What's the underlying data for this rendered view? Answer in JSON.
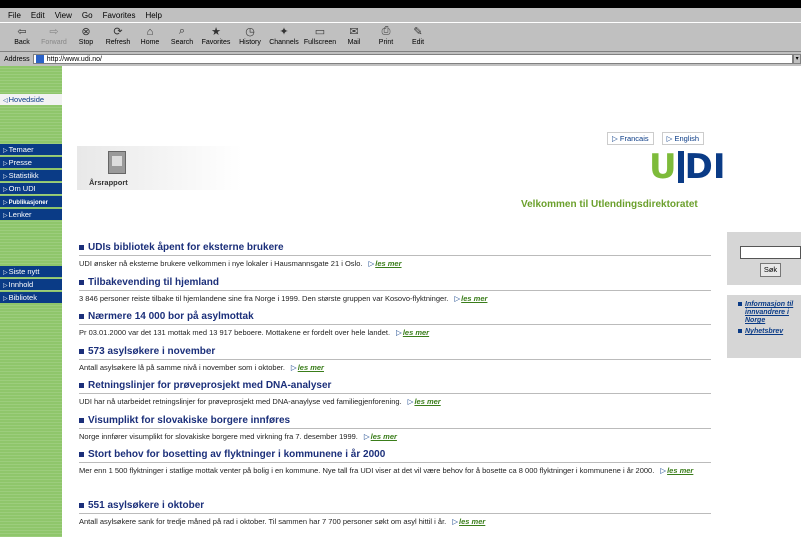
{
  "browser": {
    "menu": [
      "File",
      "Edit",
      "View",
      "Go",
      "Favorites",
      "Help"
    ],
    "toolbar": [
      {
        "label": "Back",
        "icon": "back-arrow-icon",
        "glyph": "⇦",
        "enabled": true
      },
      {
        "label": "Forward",
        "icon": "forward-arrow-icon",
        "glyph": "⇨",
        "enabled": false
      },
      {
        "label": "Stop",
        "icon": "stop-icon",
        "glyph": "⊗",
        "enabled": true
      },
      {
        "label": "Refresh",
        "icon": "refresh-icon",
        "glyph": "⟳",
        "enabled": true
      },
      {
        "label": "Home",
        "icon": "home-icon",
        "glyph": "⌂",
        "enabled": true
      },
      {
        "label": "Search",
        "icon": "search-icon",
        "glyph": "⌕",
        "enabled": true
      },
      {
        "label": "Favorites",
        "icon": "favorites-icon",
        "glyph": "★",
        "enabled": true
      },
      {
        "label": "History",
        "icon": "history-icon",
        "glyph": "◷",
        "enabled": true
      },
      {
        "label": "Channels",
        "icon": "channels-icon",
        "glyph": "✦",
        "enabled": true
      },
      {
        "label": "Fullscreen",
        "icon": "fullscreen-icon",
        "glyph": "▭",
        "enabled": true
      },
      {
        "label": "Mail",
        "icon": "mail-icon",
        "glyph": "✉",
        "enabled": true
      },
      {
        "label": "Print",
        "icon": "print-icon",
        "glyph": "⎙",
        "enabled": true
      },
      {
        "label": "Edit",
        "icon": "edit-icon",
        "glyph": "✎",
        "enabled": true
      }
    ],
    "address_label": "Address",
    "address_url": "http://www.udi.no/"
  },
  "nav": {
    "home": "Hovedside",
    "groups": [
      {
        "items": [
          "Temaer",
          "Presse",
          "Statistikk",
          "Om UDI",
          "Publikasjoner",
          "Lenker"
        ]
      },
      {
        "items": [
          "Siste nytt",
          "Innhold",
          "Bibliotek"
        ]
      }
    ]
  },
  "header": {
    "lang_fr": "Francais",
    "lang_en": "English",
    "logo_u": "U",
    "logo_di": "DI",
    "welcome": "Velkommen til Utlendingsdirektoratet",
    "annual_report": "Årsrapport"
  },
  "more_label": "les mer",
  "news": [
    {
      "title": "UDIs bibliotek åpent for eksterne brukere",
      "body": "UDI ønsker nå eksterne brukere velkommen i nye lokaler i Hausmannsgate 21 i Oslo."
    },
    {
      "title": "Tilbakevending til hjemland",
      "body": "3 846 personer reiste tilbake til hjemlandene sine fra Norge i 1999. Den største gruppen var Kosovo-flyktninger."
    },
    {
      "title": "Nærmere 14 000 bor på asylmottak",
      "body": "Pr 03.01.2000 var det 131 mottak med 13 917 beboere. Mottakene er fordelt over hele landet."
    },
    {
      "title": "573 asylsøkere i november",
      "body": "Antall asylsøkere lå på samme nivå i november som i oktober."
    },
    {
      "title": "Retningslinjer for prøveprosjekt med DNA-analyser",
      "body": "UDI har nå utarbeidet retningslinjer for prøveprosjekt med DNA-anaylyse ved familiegjenforening."
    },
    {
      "title": "Visumplikt for slovakiske borgere innføres",
      "body": "Norge innfører visumplikt for slovakiske borgere med virkning fra 7. desember 1999."
    },
    {
      "title": "Stort behov for bosetting av flyktninger i kommunene i år 2000",
      "body": "Mer enn 1 500 flyktninger i statlige mottak venter på bolig i en kommune. Nye tall fra UDI viser at det vil være behov for å bosette ca 8 000 flyktninger i kommunene i år 2000."
    },
    {
      "title": "551 asylsøkere i oktober",
      "body": "Antall asylsøkere sank for tredje måned på rad i oktober. Til sammen har 7 700 personer søkt om asyl hittil i år."
    }
  ],
  "right": {
    "search_button": "Søk",
    "links": [
      "Informasjon til innvandrere i Norge",
      "Nyhetsbrev"
    ]
  },
  "colors": {
    "nav_blue": "#0a3b86",
    "nav_green": "#8fc66b",
    "headline_blue": "#1b2f7a",
    "welcome_green": "#6ba02c"
  }
}
